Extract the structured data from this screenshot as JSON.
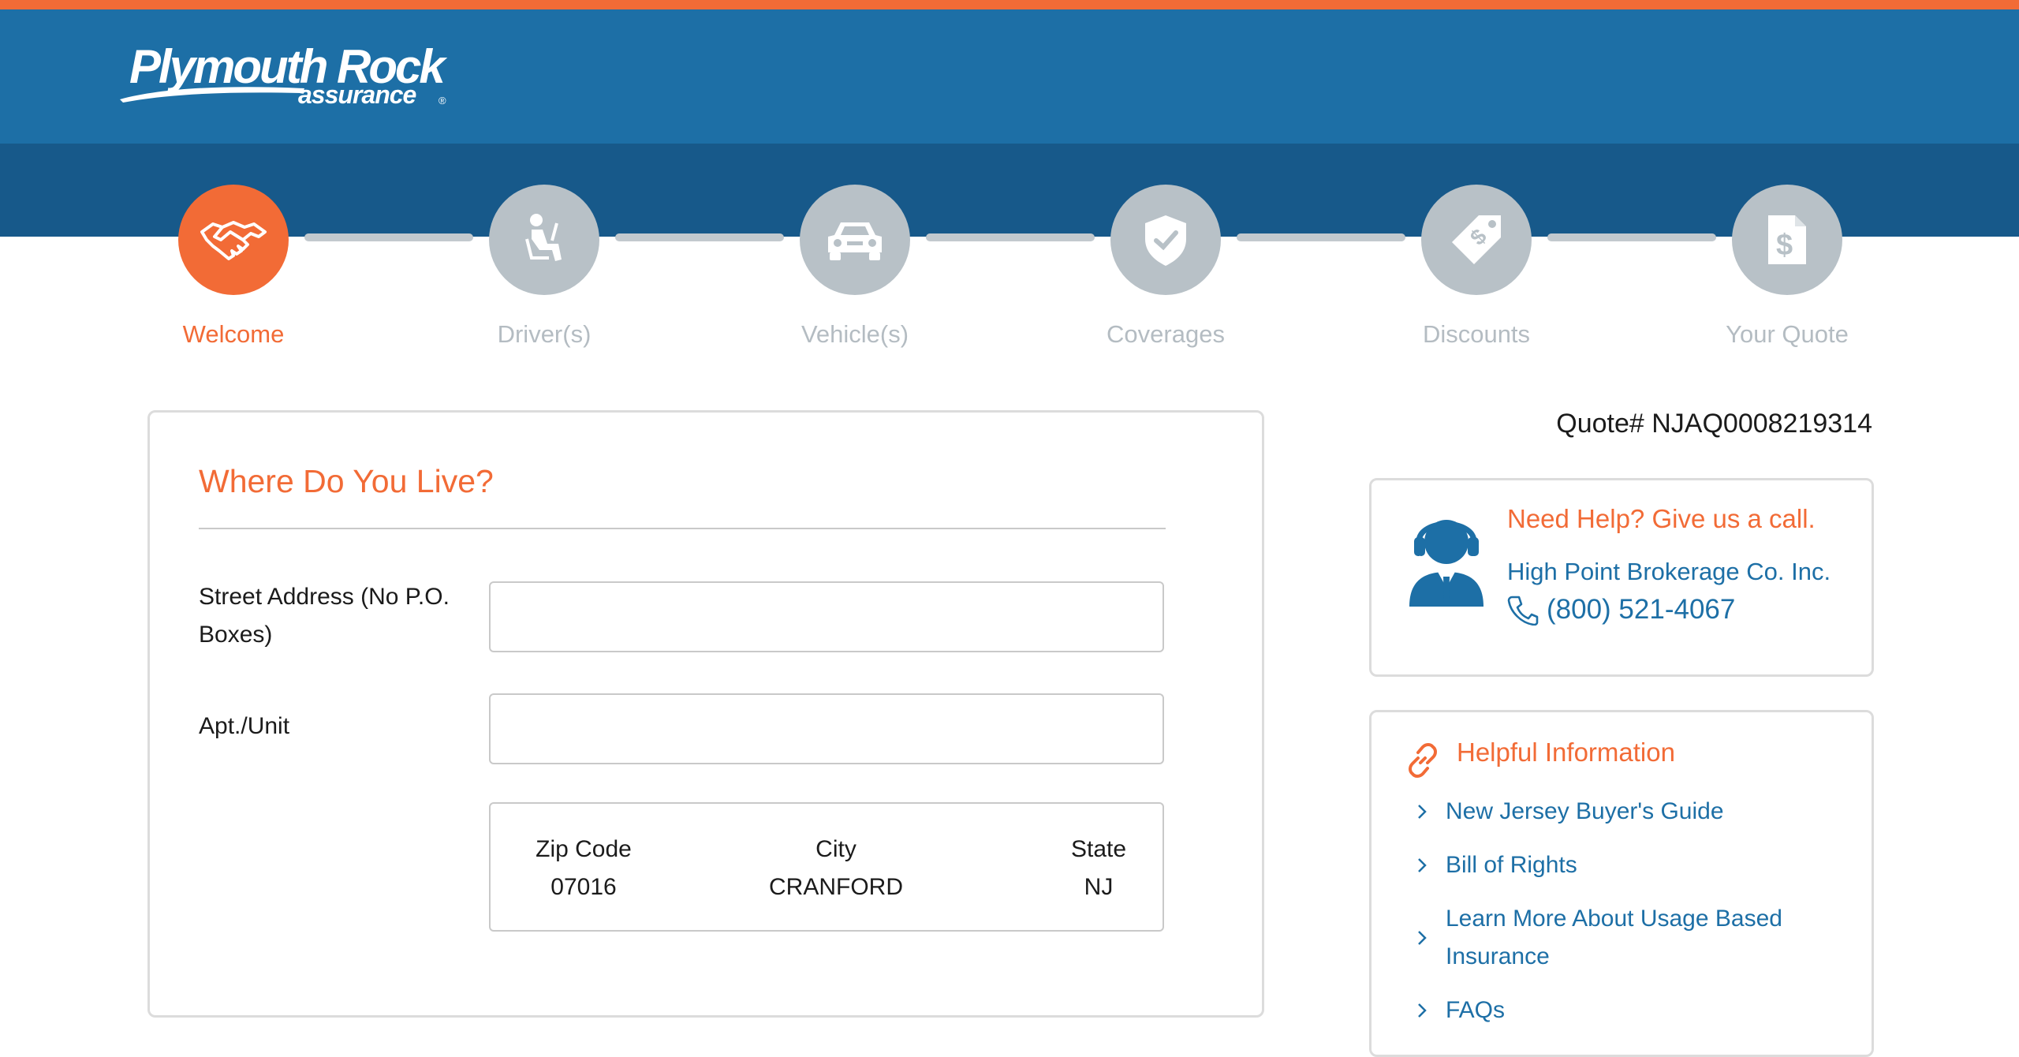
{
  "brand": {
    "logo_main": "Plymouth Rock",
    "logo_sub": "assurance",
    "logo_reg": "®",
    "colors": {
      "orange": "#f26b36",
      "blue": "#1d6fa6",
      "dark_blue": "#17598a",
      "inactive": "#b8c1c7"
    }
  },
  "steps": [
    {
      "label": "Welcome",
      "icon": "handshake-icon",
      "active": true
    },
    {
      "label": "Driver(s)",
      "icon": "seated-driver-icon",
      "active": false
    },
    {
      "label": "Vehicle(s)",
      "icon": "car-icon",
      "active": false
    },
    {
      "label": "Coverages",
      "icon": "shield-check-icon",
      "active": false
    },
    {
      "label": "Discounts",
      "icon": "price-tag-icon",
      "active": false
    },
    {
      "label": "Your Quote",
      "icon": "dollar-document-icon",
      "active": false
    }
  ],
  "form": {
    "title": "Where Do You Live?",
    "street_label": "Street Address (No P.O. Boxes)",
    "street_value": "",
    "apt_label": "Apt./Unit",
    "apt_value": "",
    "location": {
      "zip_label": "Zip Code",
      "zip_value": "07016",
      "city_label": "City",
      "city_value": "CRANFORD",
      "state_label": "State",
      "state_value": "NJ"
    }
  },
  "quote": {
    "number_text": "Quote# NJAQ0008219314"
  },
  "help": {
    "title": "Need Help? Give us a call.",
    "company": "High Point Brokerage Co. Inc.",
    "phone": "(800) 521-4067",
    "icon": "agent-headset-icon"
  },
  "info": {
    "title": "Helpful Information",
    "icon": "link-icon",
    "links": [
      "New Jersey Buyer's Guide",
      "Bill of Rights",
      "Learn More About Usage Based Insurance",
      "FAQs"
    ]
  }
}
